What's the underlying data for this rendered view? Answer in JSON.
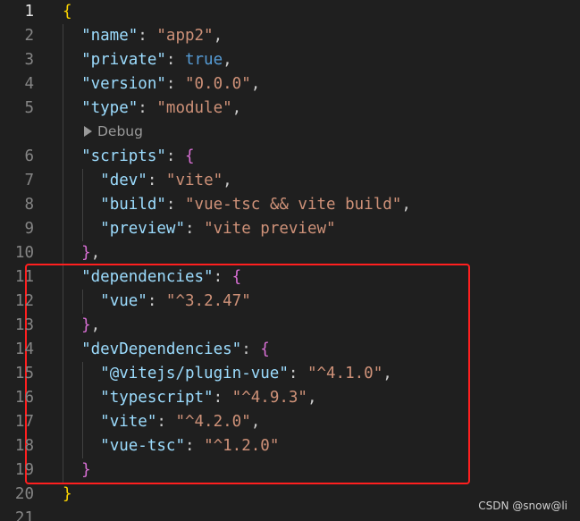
{
  "lines": [
    {
      "num": "1",
      "parts": [
        {
          "t": "{",
          "c": "b1"
        }
      ]
    },
    {
      "num": "2",
      "parts": [
        {
          "t": "  "
        },
        {
          "t": "\"name\"",
          "c": "key"
        },
        {
          "t": ": "
        },
        {
          "t": "\"app2\"",
          "c": "str"
        },
        {
          "t": ","
        }
      ]
    },
    {
      "num": "3",
      "parts": [
        {
          "t": "  "
        },
        {
          "t": "\"private\"",
          "c": "key"
        },
        {
          "t": ": "
        },
        {
          "t": "true",
          "c": "kw"
        },
        {
          "t": ","
        }
      ]
    },
    {
      "num": "4",
      "parts": [
        {
          "t": "  "
        },
        {
          "t": "\"version\"",
          "c": "key"
        },
        {
          "t": ": "
        },
        {
          "t": "\"0.0.0\"",
          "c": "str"
        },
        {
          "t": ","
        }
      ]
    },
    {
      "num": "5",
      "parts": [
        {
          "t": "  "
        },
        {
          "t": "\"type\"",
          "c": "key"
        },
        {
          "t": ": "
        },
        {
          "t": "\"module\"",
          "c": "str"
        },
        {
          "t": ","
        }
      ]
    },
    {
      "num": "6",
      "parts": [
        {
          "t": "  "
        },
        {
          "t": "\"scripts\"",
          "c": "key"
        },
        {
          "t": ": "
        },
        {
          "t": "{",
          "c": "b2"
        }
      ]
    },
    {
      "num": "7",
      "parts": [
        {
          "t": "    "
        },
        {
          "t": "\"dev\"",
          "c": "key"
        },
        {
          "t": ": "
        },
        {
          "t": "\"vite\"",
          "c": "str"
        },
        {
          "t": ","
        }
      ]
    },
    {
      "num": "8",
      "parts": [
        {
          "t": "    "
        },
        {
          "t": "\"build\"",
          "c": "key"
        },
        {
          "t": ": "
        },
        {
          "t": "\"vue-tsc && vite build\"",
          "c": "str"
        },
        {
          "t": ","
        }
      ]
    },
    {
      "num": "9",
      "parts": [
        {
          "t": "    "
        },
        {
          "t": "\"preview\"",
          "c": "key"
        },
        {
          "t": ": "
        },
        {
          "t": "\"vite preview\"",
          "c": "str"
        }
      ]
    },
    {
      "num": "10",
      "parts": [
        {
          "t": "  "
        },
        {
          "t": "}",
          "c": "b2"
        },
        {
          "t": ","
        }
      ]
    },
    {
      "num": "11",
      "parts": [
        {
          "t": "  "
        },
        {
          "t": "\"dependencies\"",
          "c": "key"
        },
        {
          "t": ": "
        },
        {
          "t": "{",
          "c": "b2"
        }
      ]
    },
    {
      "num": "12",
      "parts": [
        {
          "t": "    "
        },
        {
          "t": "\"vue\"",
          "c": "key"
        },
        {
          "t": ": "
        },
        {
          "t": "\"^3.2.47\"",
          "c": "str"
        }
      ]
    },
    {
      "num": "13",
      "parts": [
        {
          "t": "  "
        },
        {
          "t": "}",
          "c": "b2"
        },
        {
          "t": ","
        }
      ]
    },
    {
      "num": "14",
      "parts": [
        {
          "t": "  "
        },
        {
          "t": "\"devDependencies\"",
          "c": "key"
        },
        {
          "t": ": "
        },
        {
          "t": "{",
          "c": "b2"
        }
      ]
    },
    {
      "num": "15",
      "parts": [
        {
          "t": "    "
        },
        {
          "t": "\"@vitejs/plugin-vue\"",
          "c": "key"
        },
        {
          "t": ": "
        },
        {
          "t": "\"^4.1.0\"",
          "c": "str"
        },
        {
          "t": ","
        }
      ]
    },
    {
      "num": "16",
      "parts": [
        {
          "t": "    "
        },
        {
          "t": "\"typescript\"",
          "c": "key"
        },
        {
          "t": ": "
        },
        {
          "t": "\"^4.9.3\"",
          "c": "str"
        },
        {
          "t": ","
        }
      ]
    },
    {
      "num": "17",
      "parts": [
        {
          "t": "    "
        },
        {
          "t": "\"vite\"",
          "c": "key"
        },
        {
          "t": ": "
        },
        {
          "t": "\"^4.2.0\"",
          "c": "str"
        },
        {
          "t": ","
        }
      ]
    },
    {
      "num": "18",
      "parts": [
        {
          "t": "    "
        },
        {
          "t": "\"vue-tsc\"",
          "c": "key"
        },
        {
          "t": ": "
        },
        {
          "t": "\"^1.2.0\"",
          "c": "str"
        }
      ]
    },
    {
      "num": "19",
      "parts": [
        {
          "t": "  "
        },
        {
          "t": "}",
          "c": "b2"
        }
      ]
    },
    {
      "num": "20",
      "parts": [
        {
          "t": "}",
          "c": "b1"
        }
      ]
    },
    {
      "num": "21",
      "parts": []
    }
  ],
  "codelens": {
    "label": "Debug",
    "icon": "play-icon"
  },
  "highlight": {
    "color": "#ff1f1f"
  },
  "watermark": "CSDN @snow@li",
  "colors": {
    "background": "#1f1f1f",
    "key": "#9cdcfe",
    "string": "#ce9178",
    "keyword": "#569cd6",
    "bracket_outer": "#ffd700",
    "bracket_inner": "#da70d6"
  }
}
